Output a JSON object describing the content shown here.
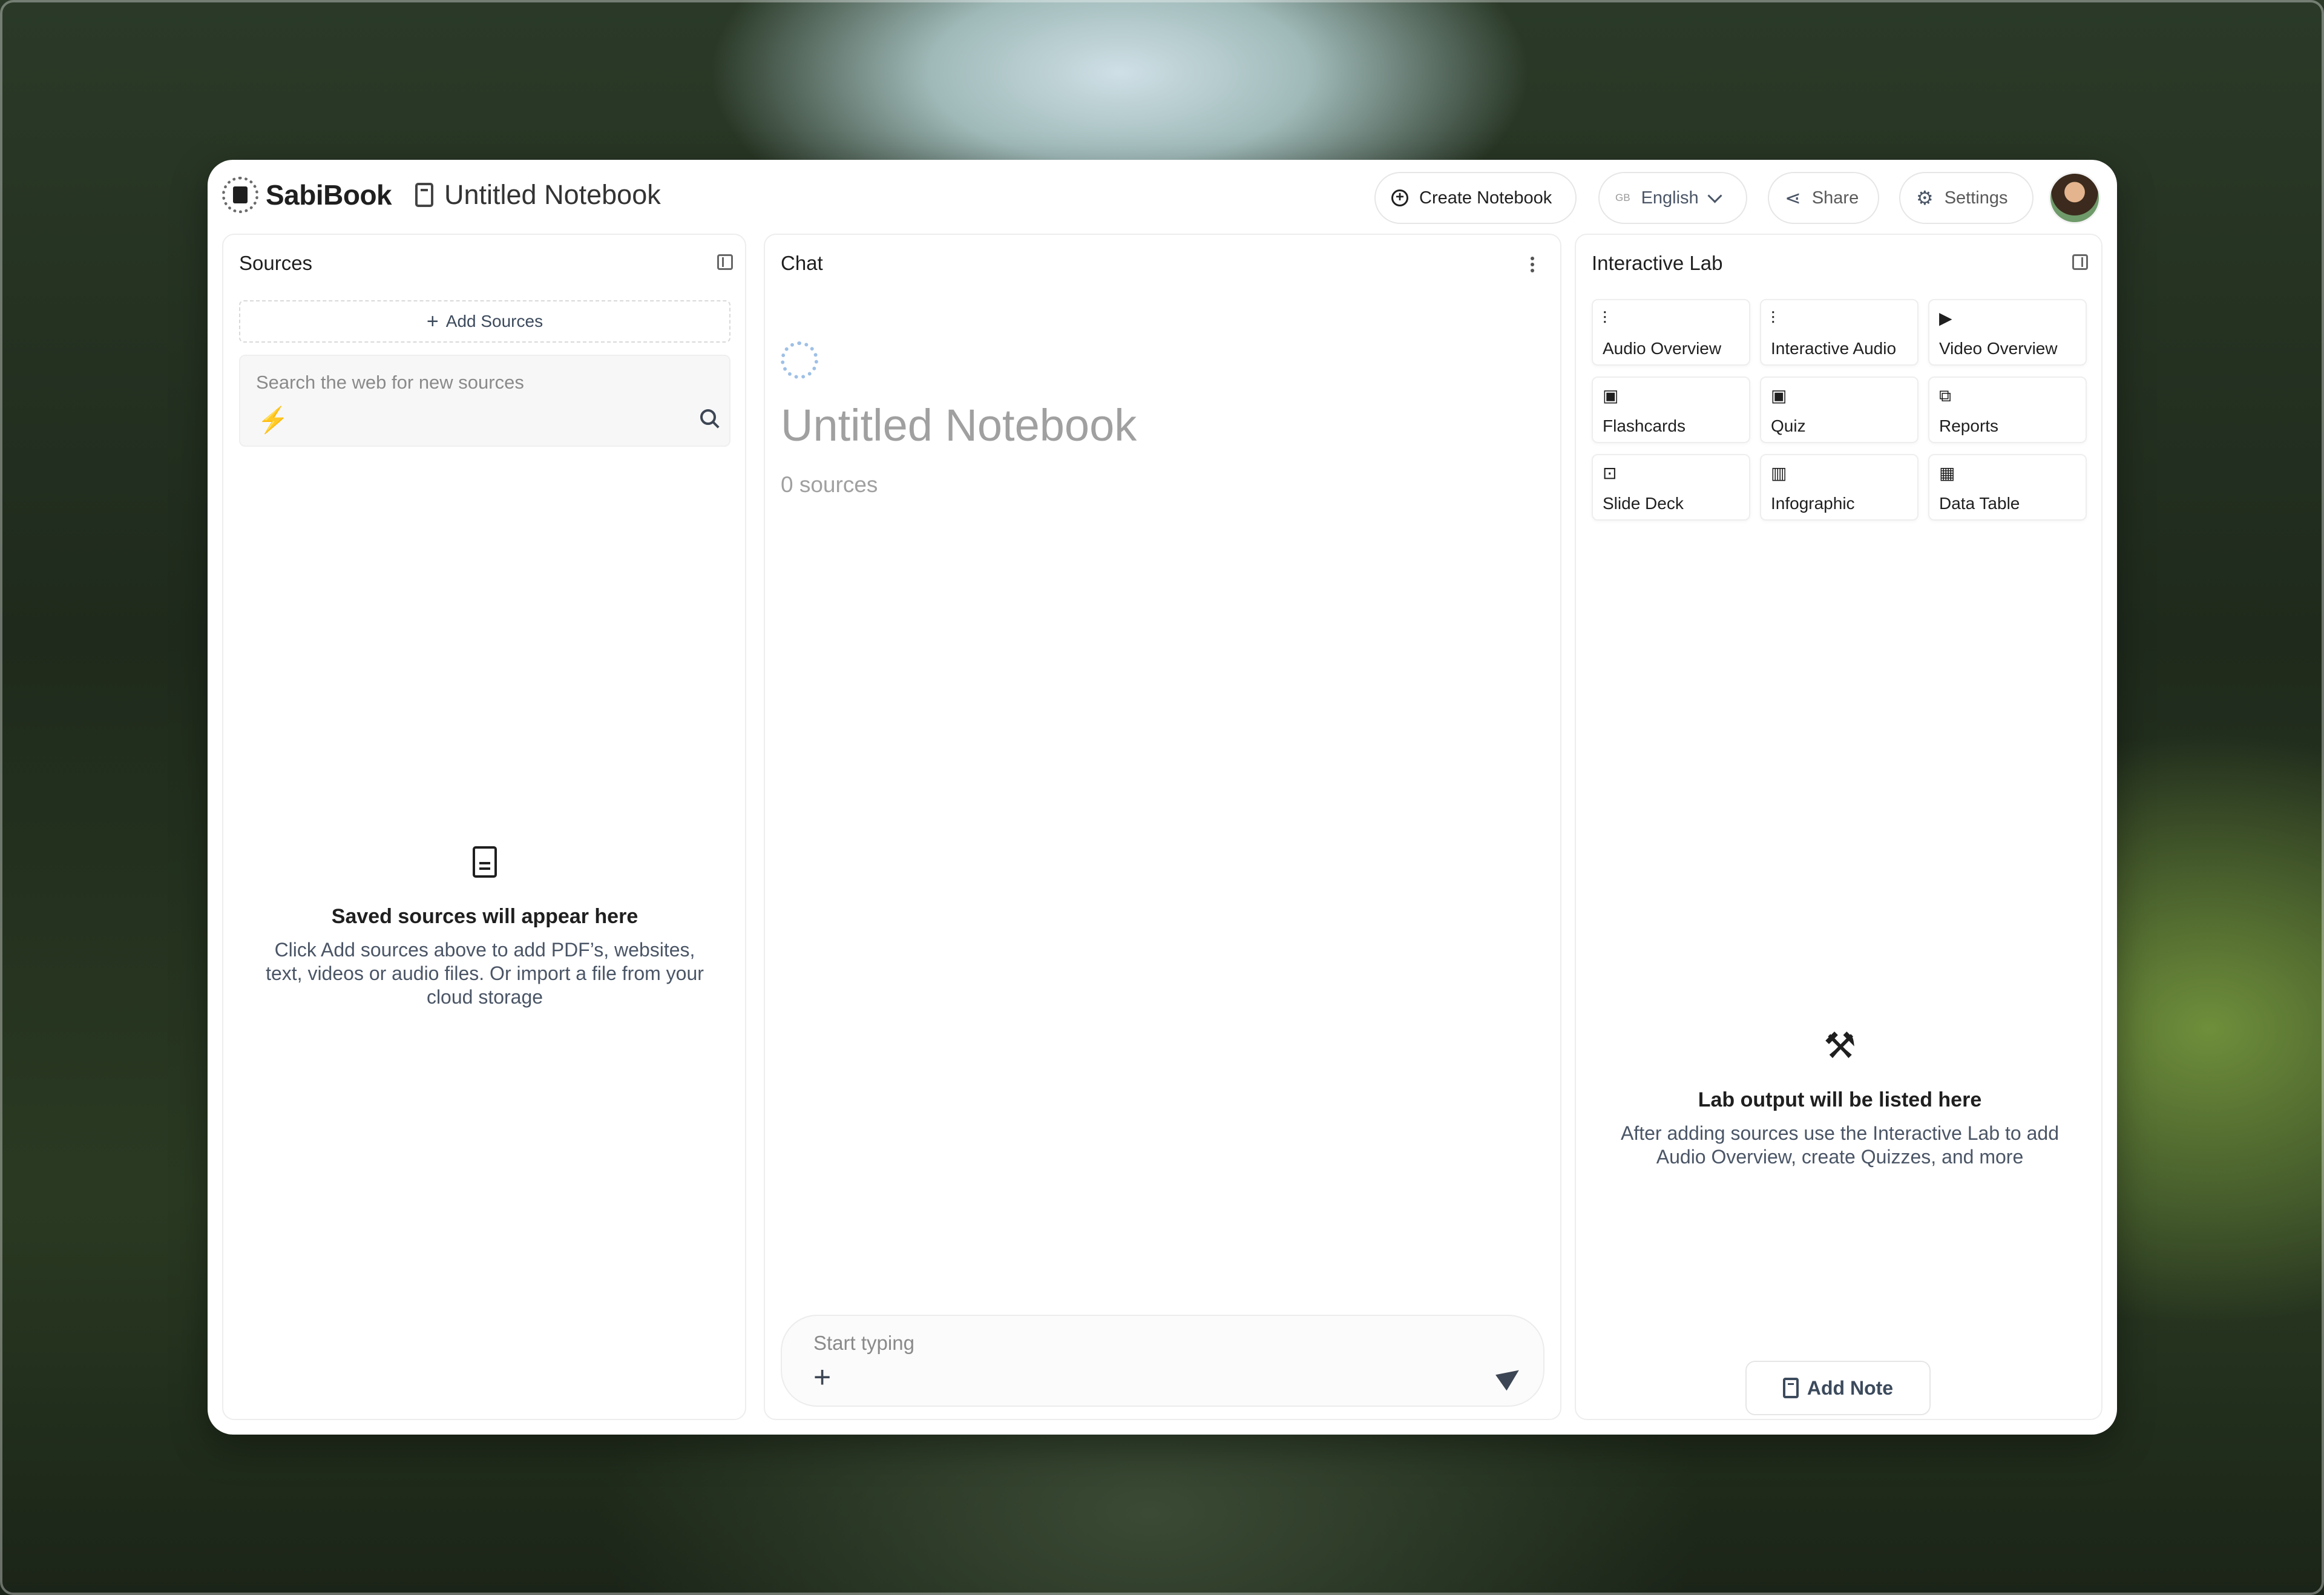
{
  "app": {
    "brand": "SabiBook",
    "notebook_title": "Untitled Notebook"
  },
  "header": {
    "create_notebook": "Create Notebook",
    "language_flag": "GB",
    "language": "English",
    "share": "Share",
    "settings": "Settings"
  },
  "sources": {
    "title": "Sources",
    "add_label": "Add Sources",
    "search_placeholder": "Search the web for new sources",
    "empty_title": "Saved sources will appear here",
    "empty_line1": "Click Add sources above to add PDF’s, websites,",
    "empty_line2": "text, videos or audio files. Or import a file from your",
    "empty_line3": "cloud storage"
  },
  "chat": {
    "title": "Chat",
    "notebook_title": "Untitled Notebook",
    "source_count": "0 sources",
    "input_placeholder": "Start typing"
  },
  "lab": {
    "title": "Interactive Lab",
    "items": [
      {
        "label": "Audio Overview",
        "icon": "audio-wave-icon"
      },
      {
        "label": "Interactive Audio",
        "icon": "interactive-audio-icon"
      },
      {
        "label": "Video Overview",
        "icon": "video-icon"
      },
      {
        "label": "Flashcards",
        "icon": "flashcards-icon"
      },
      {
        "label": "Quiz",
        "icon": "quiz-icon"
      },
      {
        "label": "Reports",
        "icon": "reports-icon"
      },
      {
        "label": "Slide Deck",
        "icon": "slide-deck-icon"
      },
      {
        "label": "Infographic",
        "icon": "infographic-icon"
      },
      {
        "label": "Data Table",
        "icon": "data-table-icon"
      }
    ],
    "empty_title": "Lab output will be listed here",
    "empty_line1": "After adding sources use the Interactive Lab to add",
    "empty_line2": "Audio Overview, create Quizzes, and more",
    "add_note": "Add Note"
  }
}
